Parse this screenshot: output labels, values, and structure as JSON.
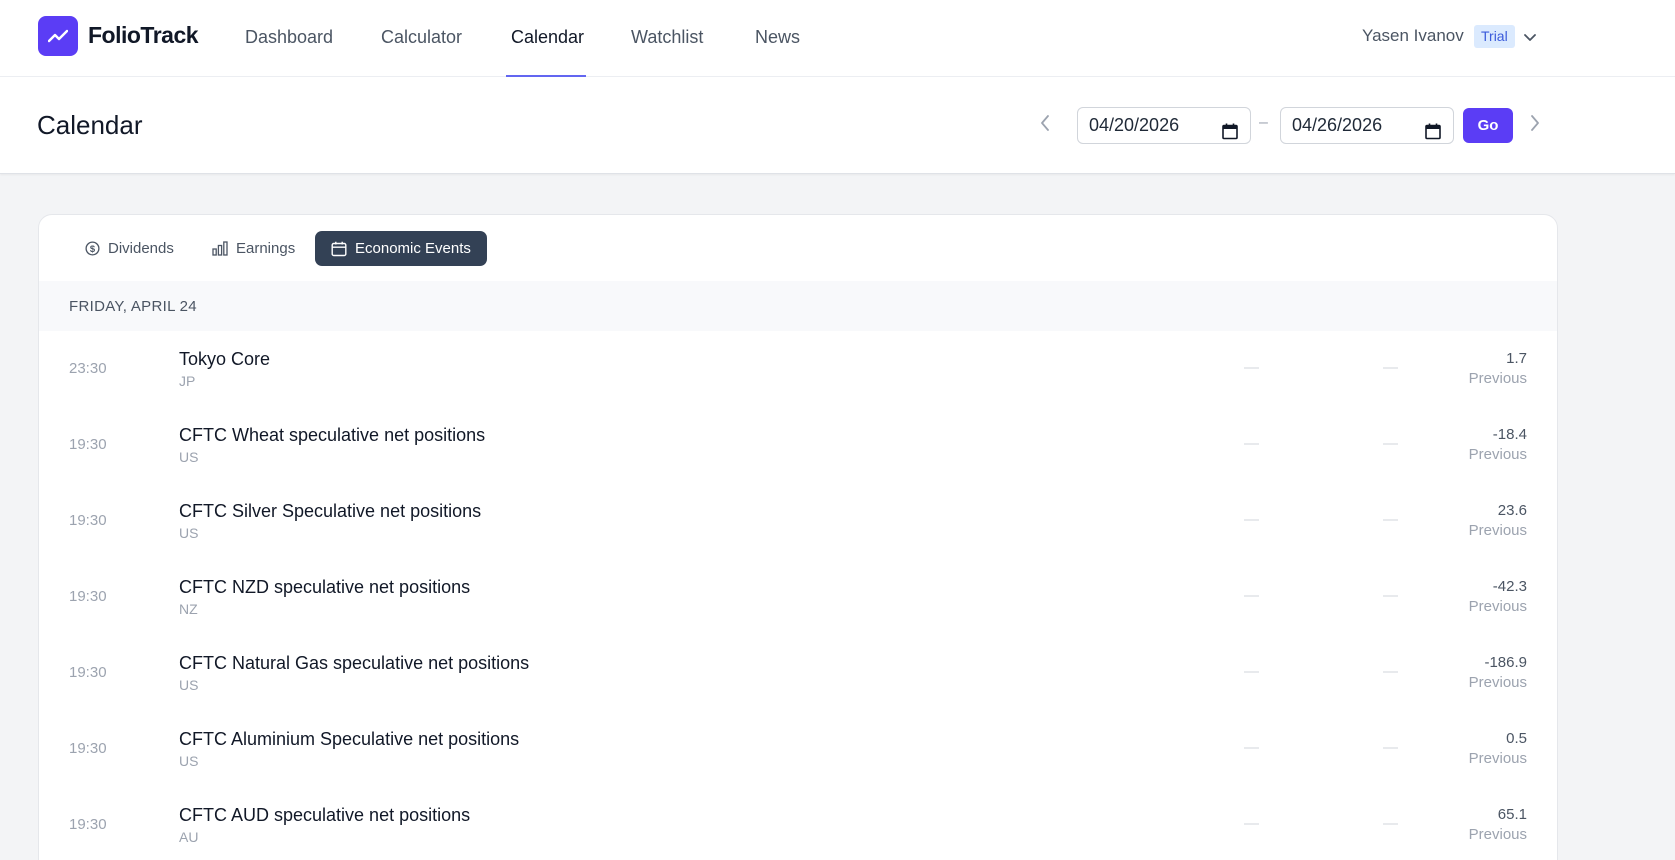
{
  "app": {
    "name": "FolioTrack"
  },
  "nav": {
    "items": [
      {
        "label": "Dashboard",
        "active": false
      },
      {
        "label": "Calculator",
        "active": false
      },
      {
        "label": "Calendar",
        "active": true
      },
      {
        "label": "Watchlist",
        "active": false
      },
      {
        "label": "News",
        "active": false
      }
    ]
  },
  "user": {
    "name": "Yasen Ivanov",
    "plan_badge": "Trial"
  },
  "page": {
    "title": "Calendar",
    "date_from": "04/20/2026",
    "date_separator": "–",
    "date_to": "04/26/2026",
    "go_label": "Go"
  },
  "tabs": [
    {
      "label": "Dividends",
      "icon": "dollar-circle-icon",
      "active": false
    },
    {
      "label": "Earnings",
      "icon": "bar-chart-icon",
      "active": false
    },
    {
      "label": "Economic Events",
      "icon": "calendar-icon",
      "active": true
    }
  ],
  "day": {
    "header": "FRIDAY, APRIL 24",
    "empty_value": "—",
    "previous_label": "Previous",
    "events": [
      {
        "time": "23:30",
        "name": "Tokyo Core",
        "country": "JP",
        "previous": "1.7"
      },
      {
        "time": "19:30",
        "name": "CFTC Wheat speculative net positions",
        "country": "US",
        "previous": "-18.4"
      },
      {
        "time": "19:30",
        "name": "CFTC Silver Speculative net positions",
        "country": "US",
        "previous": "23.6"
      },
      {
        "time": "19:30",
        "name": "CFTC NZD speculative net positions",
        "country": "NZ",
        "previous": "-42.3"
      },
      {
        "time": "19:30",
        "name": "CFTC Natural Gas speculative net positions",
        "country": "US",
        "previous": "-186.9"
      },
      {
        "time": "19:30",
        "name": "CFTC Aluminium Speculative net positions",
        "country": "US",
        "previous": "0.5"
      },
      {
        "time": "19:30",
        "name": "CFTC AUD speculative net positions",
        "country": "AU",
        "previous": "65.1"
      }
    ]
  },
  "colors": {
    "brand": "#5b3df5",
    "active_tab": "#334155",
    "nav_underline": "#6366f1"
  }
}
